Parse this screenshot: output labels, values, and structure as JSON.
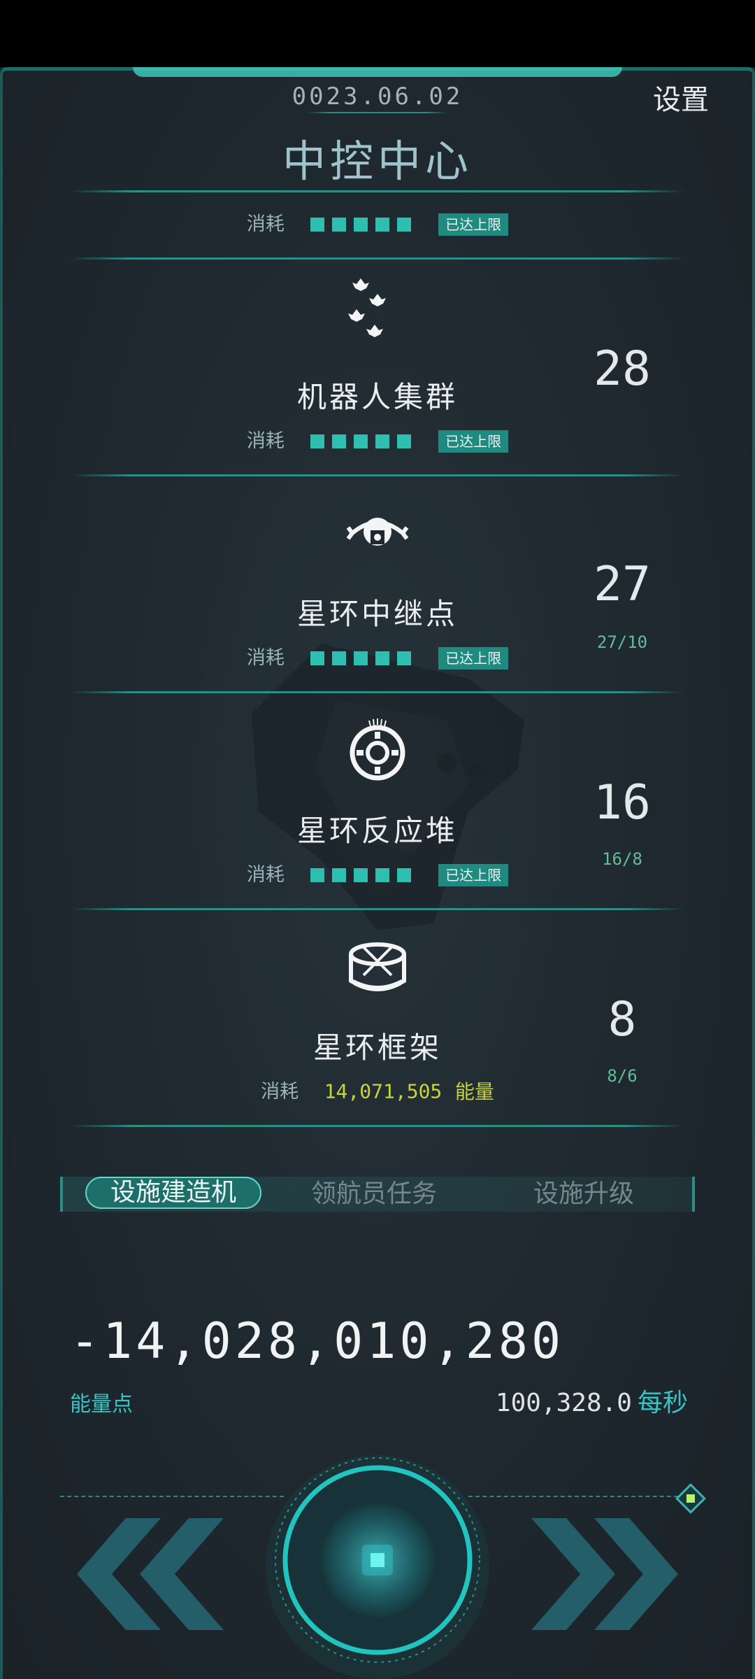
{
  "header": {
    "date": "0023.06.02",
    "settings_label": "设置",
    "title": "中控中心"
  },
  "top_consume": {
    "label": "消耗",
    "pips": 5,
    "badge": "已达上限"
  },
  "items": [
    {
      "name": "机器人集群",
      "count": "28",
      "ratio": "",
      "consume_label": "消耗",
      "pips": 5,
      "badge": "已达上限",
      "icon": "robot-swarm-icon"
    },
    {
      "name": "星环中继点",
      "count": "27",
      "ratio": "27/10",
      "consume_label": "消耗",
      "pips": 5,
      "badge": "已达上限",
      "icon": "relay-station-icon"
    },
    {
      "name": "星环反应堆",
      "count": "16",
      "ratio": "16/8",
      "consume_label": "消耗",
      "pips": 5,
      "badge": "已达上限",
      "icon": "reactor-icon"
    },
    {
      "name": "星环框架",
      "count": "8",
      "ratio": "8/6",
      "consume_label": "消耗",
      "cost": "14,071,505",
      "cost_unit": "能量",
      "icon": "ring-frame-icon"
    }
  ],
  "tabs": [
    {
      "label": "设施建造机",
      "active": true
    },
    {
      "label": "领航员任务",
      "active": false
    },
    {
      "label": "设施升级",
      "active": false
    }
  ],
  "energy": {
    "value": "-14,028,010,280",
    "label": "能量点",
    "rate": "100,328.0",
    "rate_unit": "每秒"
  },
  "colors": {
    "accent": "#2fbfb0",
    "badge": "#1f8a80",
    "cost": "#c9d33a",
    "background": "#1c252b"
  }
}
